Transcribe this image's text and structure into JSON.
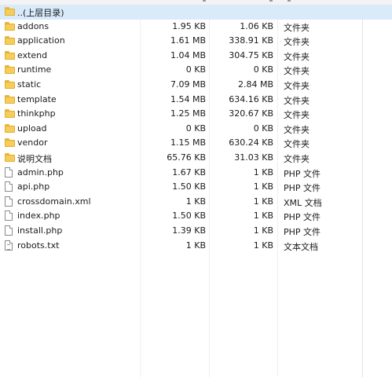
{
  "list": {
    "rows": [
      {
        "name": "..(上层目录)",
        "size": "",
        "packed": "",
        "type": "",
        "icon": "folder-icon"
      },
      {
        "name": "addons",
        "size": "1.95 KB",
        "packed": "1.06 KB",
        "type": "文件夹",
        "icon": "folder-icon"
      },
      {
        "name": "application",
        "size": "1.61 MB",
        "packed": "338.91 KB",
        "type": "文件夹",
        "icon": "folder-icon"
      },
      {
        "name": "extend",
        "size": "1.04 MB",
        "packed": "304.75 KB",
        "type": "文件夹",
        "icon": "folder-icon"
      },
      {
        "name": "runtime",
        "size": "0 KB",
        "packed": "0 KB",
        "type": "文件夹",
        "icon": "folder-icon"
      },
      {
        "name": "static",
        "size": "7.09 MB",
        "packed": "2.84 MB",
        "type": "文件夹",
        "icon": "folder-icon"
      },
      {
        "name": "template",
        "size": "1.54 MB",
        "packed": "634.16 KB",
        "type": "文件夹",
        "icon": "folder-icon"
      },
      {
        "name": "thinkphp",
        "size": "1.25 MB",
        "packed": "320.67 KB",
        "type": "文件夹",
        "icon": "folder-icon"
      },
      {
        "name": "upload",
        "size": "0 KB",
        "packed": "0 KB",
        "type": "文件夹",
        "icon": "folder-icon"
      },
      {
        "name": "vendor",
        "size": "1.15 MB",
        "packed": "630.24 KB",
        "type": "文件夹",
        "icon": "folder-icon"
      },
      {
        "name": "说明文档",
        "size": "65.76 KB",
        "packed": "31.03 KB",
        "type": "文件夹",
        "icon": "folder-icon"
      },
      {
        "name": "admin.php",
        "size": "1.67 KB",
        "packed": "1 KB",
        "type": "PHP 文件",
        "icon": "file-icon"
      },
      {
        "name": "api.php",
        "size": "1.50 KB",
        "packed": "1 KB",
        "type": "PHP 文件",
        "icon": "file-icon"
      },
      {
        "name": "crossdomain.xml",
        "size": "1 KB",
        "packed": "1 KB",
        "type": "XML 文档",
        "icon": "file-icon"
      },
      {
        "name": "index.php",
        "size": "1.50 KB",
        "packed": "1 KB",
        "type": "PHP 文件",
        "icon": "file-icon"
      },
      {
        "name": "install.php",
        "size": "1.39 KB",
        "packed": "1 KB",
        "type": "PHP 文件",
        "icon": "file-icon"
      },
      {
        "name": "robots.txt",
        "size": "1 KB",
        "packed": "1 KB",
        "type": "文本文档",
        "icon": "text-file-icon"
      }
    ]
  }
}
